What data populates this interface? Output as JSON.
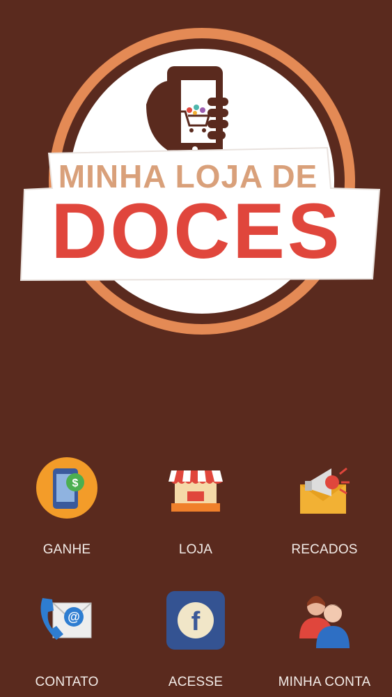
{
  "logo": {
    "line1": "MINHA LOJA DE",
    "line2": "DOCES"
  },
  "colors": {
    "background": "#5a2a1e",
    "ring": "#e48a55",
    "brand_red": "#e0463c",
    "brand_tan": "#d9a07a"
  },
  "menu": [
    {
      "label": "GANHE",
      "icon": "phone-money-icon"
    },
    {
      "label": "LOJA",
      "icon": "storefront-icon"
    },
    {
      "label": "RECADOS",
      "icon": "megaphone-envelope-icon"
    },
    {
      "label": "CONTATO",
      "icon": "phone-email-icon"
    },
    {
      "label": "ACESSE",
      "icon": "facebook-icon"
    },
    {
      "label": "MINHA CONTA",
      "icon": "users-icon"
    }
  ]
}
